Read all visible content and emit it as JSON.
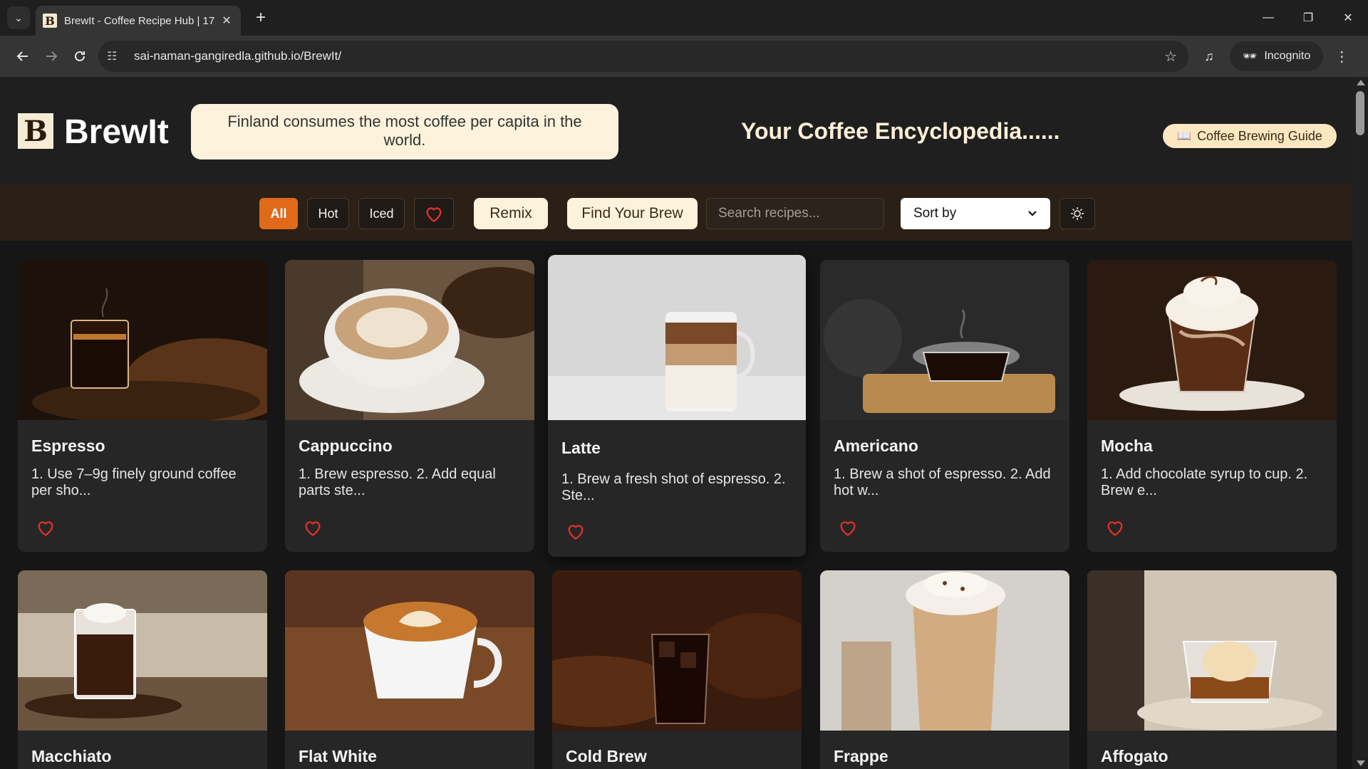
{
  "browser": {
    "tab_title": "BrewIt - Coffee Recipe Hub | 17",
    "tab_favicon_letter": "B",
    "url": "sai-naman-gangiredla.github.io/BrewIt/",
    "incognito_label": "Incognito"
  },
  "header": {
    "logo_letter": "B",
    "site_name": "BrewIt",
    "fact": "Finland consumes the most coffee per capita in the world.",
    "tagline": "Your Coffee Encyclopedia......",
    "guide_button": "Coffee Brewing Guide",
    "guide_icon": "book-icon"
  },
  "filters": {
    "all": "All",
    "hot": "Hot",
    "iced": "Iced",
    "favorites_icon": "heart-icon",
    "remix": "Remix",
    "find_brew": "Find Your Brew",
    "search_placeholder": "Search recipes...",
    "sort_selected": "Sort by",
    "theme_icon": "sun-icon"
  },
  "recipes": [
    {
      "name": "Espresso",
      "desc": "1. Use 7–9g finely ground coffee per sho..."
    },
    {
      "name": "Cappuccino",
      "desc": "1. Brew espresso. 2. Add equal parts ste..."
    },
    {
      "name": "Latte",
      "desc": "1. Brew a fresh shot of espresso. 2. Ste..."
    },
    {
      "name": "Americano",
      "desc": "1. Brew a shot of espresso. 2. Add hot w..."
    },
    {
      "name": "Mocha",
      "desc": "1. Add chocolate syrup to cup. 2. Brew e..."
    },
    {
      "name": "Macchiato",
      "desc": ""
    },
    {
      "name": "Flat White",
      "desc": ""
    },
    {
      "name": "Cold Brew",
      "desc": ""
    },
    {
      "name": "Frappe",
      "desc": ""
    },
    {
      "name": "Affogato",
      "desc": ""
    }
  ],
  "colors": {
    "accent": "#e06a1a",
    "cream": "#fdf3dc",
    "heart": "#e0302a"
  }
}
